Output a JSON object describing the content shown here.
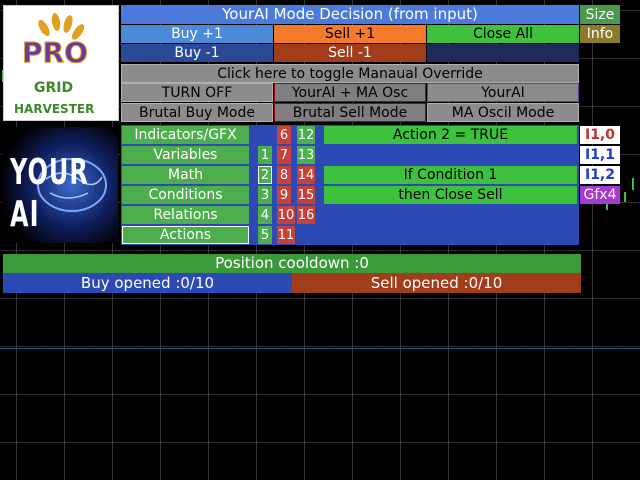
{
  "header": {
    "title": "YourAI Mode Decision (from input)",
    "size_label": "Size",
    "info_label": "Info"
  },
  "trade_buttons": {
    "buy_plus": "Buy +1",
    "sell_plus": "Sell +1",
    "close_all": "Close All",
    "buy_minus": "Buy -1",
    "sell_minus": "Sell -1"
  },
  "override": "Click here to toggle Manaual Override",
  "modes": {
    "turn_off": "TURN OFF",
    "yourai_ma": "YourAI + MA Osc",
    "yourai": "YourAI",
    "brutal_buy": "Brutal Buy Mode",
    "brutal_sell": "Brutal Sell Mode",
    "ma_oscil": "MA Oscil Mode"
  },
  "categories": [
    "Indicators/GFX",
    "Variables",
    "Math",
    "Conditions",
    "Relations",
    "Actions"
  ],
  "num_col1": [
    "",
    "1",
    "2",
    "3",
    "4",
    "5"
  ],
  "num_col2": [
    "6",
    "7",
    "8",
    "9",
    "10",
    "11"
  ],
  "num_col3": [
    "12",
    "13",
    "14",
    "15",
    "16",
    ""
  ],
  "rules": {
    "row1": "Action 2 = TRUE",
    "row3": "If Condition 1",
    "row4": "then Close Sell"
  },
  "right_tags": [
    "I1,0",
    "I1,1",
    "I1,2",
    "Gfx4"
  ],
  "cooldown": "Position cooldown :0",
  "buy_opened": "Buy opened :0/10",
  "sell_opened": "Sell opened :0/10",
  "logo": {
    "pro": "PRO",
    "grid": "GRID",
    "harvester": "HARVESTER",
    "yourai": "YOUR AI"
  },
  "colors": {
    "green": "#4cae4c",
    "blue": "#2c49b5",
    "orange": "#f47a2c",
    "brown": "#a23d1c",
    "red": "#c5423a",
    "purple": "#a53ad0"
  }
}
